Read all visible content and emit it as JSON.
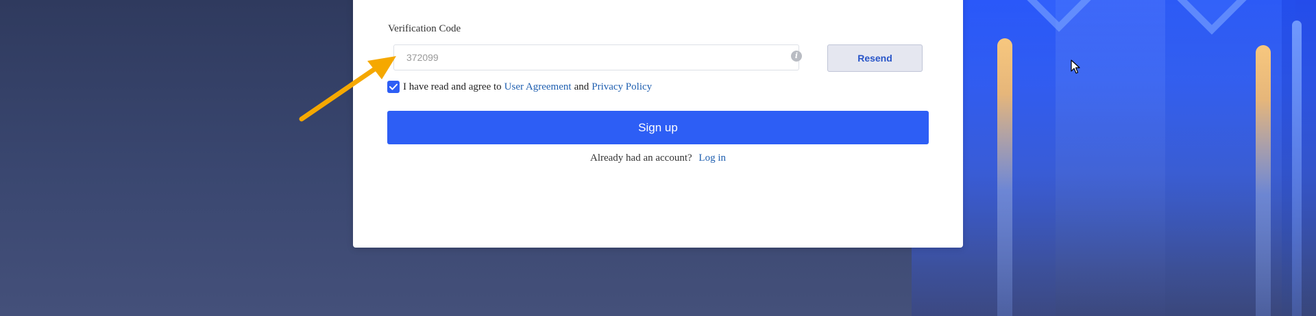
{
  "form": {
    "verification_label": "Verification Code",
    "code_value": "372099",
    "code_placeholder": "",
    "resend_label": "Resend",
    "agree_checked": true,
    "agree_text": "I have read and agree to",
    "user_agreement_link": "User Agreement",
    "and_text": "and",
    "privacy_policy_link": "Privacy Policy",
    "signup_label": "Sign up",
    "login_prompt": "Already had an account?",
    "login_link": "Log in"
  },
  "icons": {
    "info": "info-icon",
    "checkbox": "check-icon",
    "cursor": "mouse-cursor-icon",
    "annotation": "annotation-arrow"
  },
  "colors": {
    "primary": "#2d5ef5",
    "link": "#1f5fb0",
    "resend_text": "#2855c8",
    "arrow": "#f5a800",
    "background": "#3a4770"
  }
}
